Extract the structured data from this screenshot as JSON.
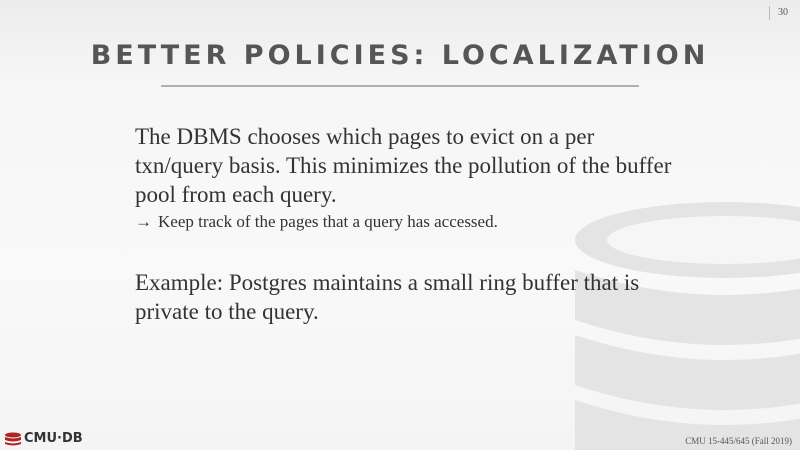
{
  "slide": {
    "page_number": "30",
    "title": "BETTER POLICIES: LOCALIZATION",
    "body": {
      "paragraph1": "The DBMS chooses which pages to evict on a per txn/query basis. This minimizes the pollution of the buffer pool from each query.",
      "bullet_arrow": "→",
      "bullet": "Keep track of the pages that a query has accessed.",
      "paragraph2": "Example: Postgres maintains a small ring buffer that is private to the query."
    },
    "logo_text": "CMU·DB",
    "footer": "CMU 15-445/645 (Fall 2019)",
    "colors": {
      "logo_red": "#b22222",
      "title": "#555555",
      "rule": "#b0b0b0"
    },
    "watermark_icon": "database-cylinder-icon"
  }
}
